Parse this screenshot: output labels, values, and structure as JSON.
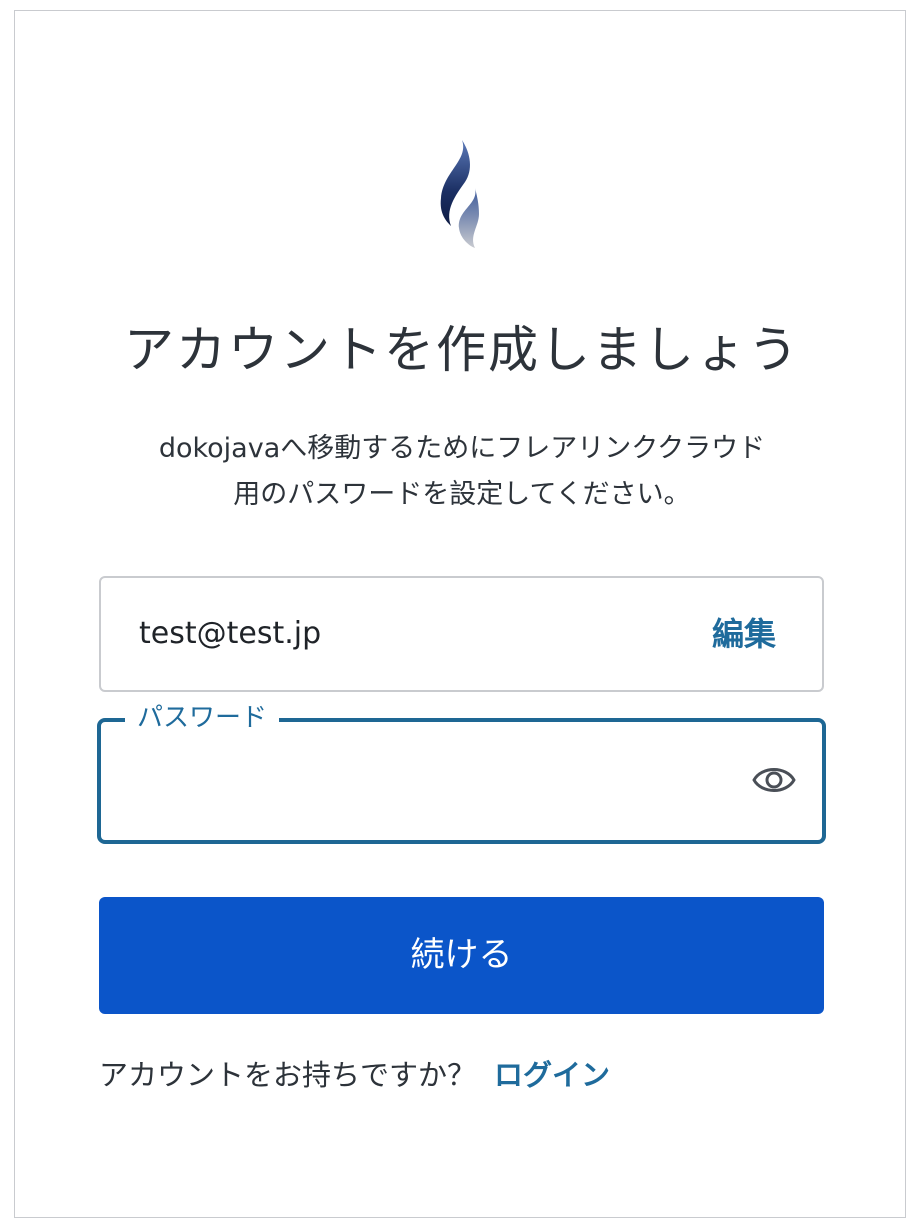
{
  "logo": {
    "icon": "flame-logo-icon",
    "colors": [
      "#1b2f63",
      "#5b79b8",
      "#b9bcc2"
    ]
  },
  "page": {
    "title": "アカウントを作成しましょう",
    "subtitle_line1": "dokojavaへ移動するためにフレアリンククラウド",
    "subtitle_line2": "用のパスワードを設定してください。"
  },
  "email": {
    "value": "test@test.jp",
    "edit_label": "編集"
  },
  "password": {
    "label": "パスワード",
    "value": "",
    "toggle_icon": "eye-icon"
  },
  "continue_button": {
    "label": "続ける",
    "color": "#0b55c9"
  },
  "footer": {
    "prompt": "アカウントをお持ちですか？",
    "login_label": "ログイン"
  },
  "colors": {
    "accent": "#1f6b9c",
    "focus_border": "#1e6794"
  }
}
